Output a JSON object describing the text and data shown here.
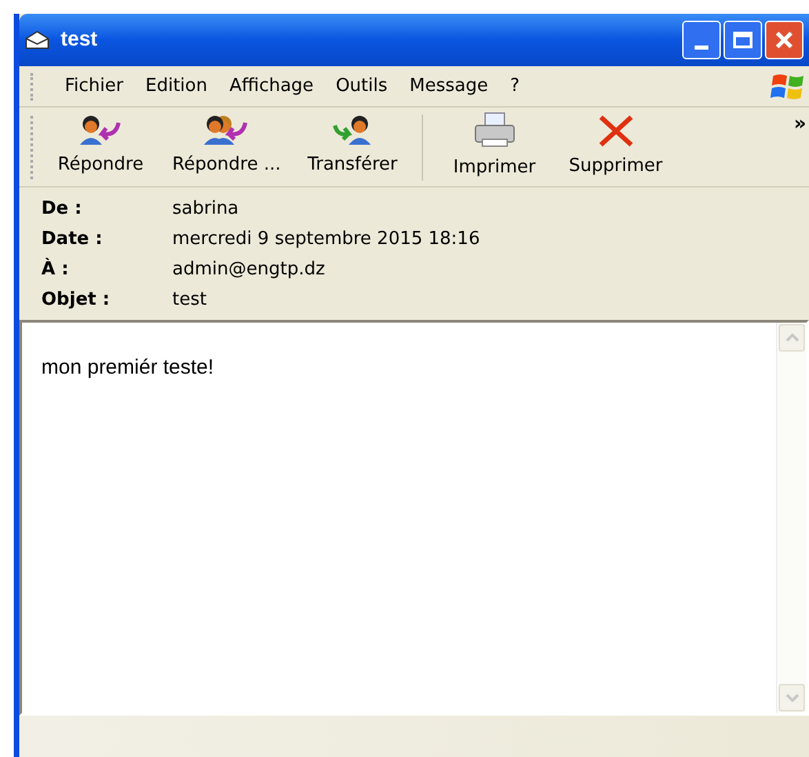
{
  "window": {
    "title": "test"
  },
  "menu": [
    "Fichier",
    "Edition",
    "Affichage",
    "Outils",
    "Message",
    "?"
  ],
  "toolbar": [
    {
      "kind": "reply",
      "label": "Répondre"
    },
    {
      "kind": "reply-all",
      "label": "Répondre ..."
    },
    {
      "kind": "forward",
      "label": "Transférer"
    },
    {
      "kind": "print",
      "label": "Imprimer"
    },
    {
      "kind": "delete",
      "label": "Supprimer"
    }
  ],
  "toolbar_overflow": "»",
  "headers": [
    {
      "label": "De :",
      "value": "sabrina"
    },
    {
      "label": "Date :",
      "value": "mercredi 9 septembre 2015 18:16"
    },
    {
      "label": "À :",
      "value": "admin@engtp.dz"
    },
    {
      "label": "Objet :",
      "value": "test"
    }
  ],
  "body": "mon premiér teste!"
}
